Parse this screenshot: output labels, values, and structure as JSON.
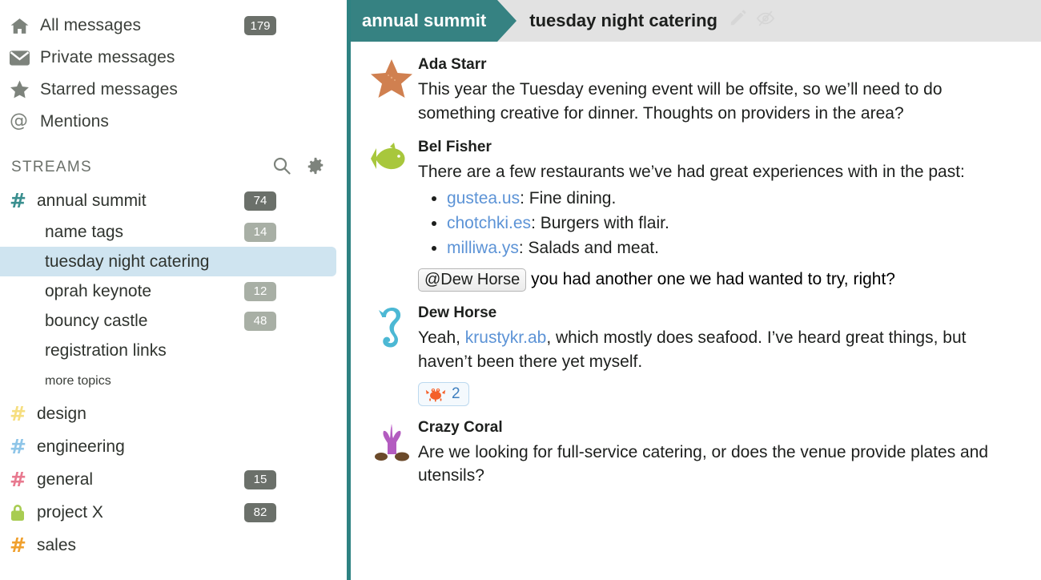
{
  "colors": {
    "accent_teal": "#368282",
    "pane_border": "#2e8282",
    "selected_topic_bg": "#cfe4f0",
    "badge_dark": "#6b706a",
    "badge_light": "#a8afa5",
    "link_blue": "#5c93d6",
    "topic_bar_bg": "#e2e2e2"
  },
  "sidebar": {
    "nav": [
      {
        "icon": "home-icon",
        "label": "All messages",
        "badge": "179",
        "badge_style": "dark"
      },
      {
        "icon": "envelope-icon",
        "label": "Private messages",
        "badge": "",
        "badge_style": ""
      },
      {
        "icon": "star-icon",
        "label": "Starred messages",
        "badge": "",
        "badge_style": ""
      },
      {
        "icon": "at-icon",
        "label": "Mentions",
        "badge": "",
        "badge_style": ""
      }
    ],
    "streams_section": {
      "title": "STREAMS",
      "search_icon": "search-icon",
      "settings_icon": "gear-icon"
    },
    "streams": [
      {
        "name": "annual summit",
        "icon": "hash-icon",
        "color": "#3a8f8f",
        "badge": "74",
        "badge_style": "dark",
        "topics": [
          {
            "name": "name tags",
            "badge": "14",
            "selected": false
          },
          {
            "name": "tuesday night catering",
            "badge": "",
            "selected": true
          },
          {
            "name": "oprah keynote",
            "badge": "12",
            "selected": false
          },
          {
            "name": "bouncy castle",
            "badge": "48",
            "selected": false
          },
          {
            "name": "registration links",
            "badge": "",
            "selected": false
          }
        ],
        "more_topics_label": "more topics"
      },
      {
        "name": "design",
        "icon": "hash-icon",
        "color": "#f6de7f",
        "badge": "",
        "badge_style": "",
        "topics": []
      },
      {
        "name": "engineering",
        "icon": "hash-icon",
        "color": "#8ec5e8",
        "badge": "",
        "badge_style": "",
        "topics": []
      },
      {
        "name": "general",
        "icon": "hash-icon",
        "color": "#e8798f",
        "badge": "15",
        "badge_style": "dark",
        "topics": []
      },
      {
        "name": "project X",
        "icon": "lock-icon",
        "color": "#a8cc52",
        "badge": "82",
        "badge_style": "dark",
        "topics": []
      },
      {
        "name": "sales",
        "icon": "hash-icon",
        "color": "#f0a02e",
        "badge": "",
        "badge_style": "",
        "topics": []
      }
    ]
  },
  "topic_bar": {
    "stream_label": "annual summit",
    "topic_label": "tuesday night catering",
    "edit_icon": "pencil-icon",
    "mute_icon": "eye-slash-icon"
  },
  "messages": [
    {
      "avatar": "starfish-avatar",
      "sender": "Ada Starr",
      "text": "This year the Tuesday evening event will be offsite, so we’ll need to do something creative for dinner. Thoughts on providers in the area?"
    },
    {
      "avatar": "fish-avatar",
      "sender": "Bel Fisher",
      "text": "There are a few restaurants we’ve had great experiences with in the past:",
      "list": [
        {
          "link": "gustea.us",
          "rest": ": Fine dining."
        },
        {
          "link": "chotchki.es",
          "rest": ": Burgers with flair."
        },
        {
          "link": "milliwa.ys",
          "rest": ": Salads and meat."
        }
      ],
      "mention": "@Dew Horse",
      "mention_rest": "you had another one we had wanted to try, right?"
    },
    {
      "avatar": "seahorse-avatar",
      "sender": "Dew Horse",
      "text_before": "Yeah, ",
      "link": "krustykr.ab",
      "text_after": ", which mostly does seafood. I’ve heard great things, but haven’t been there yet myself.",
      "reaction": {
        "emoji": "crab-emoji",
        "count": "2"
      }
    },
    {
      "avatar": "coral-avatar",
      "sender": "Crazy Coral",
      "text": "Are we looking for full-service catering, or does the venue provide plates and utensils?"
    }
  ]
}
